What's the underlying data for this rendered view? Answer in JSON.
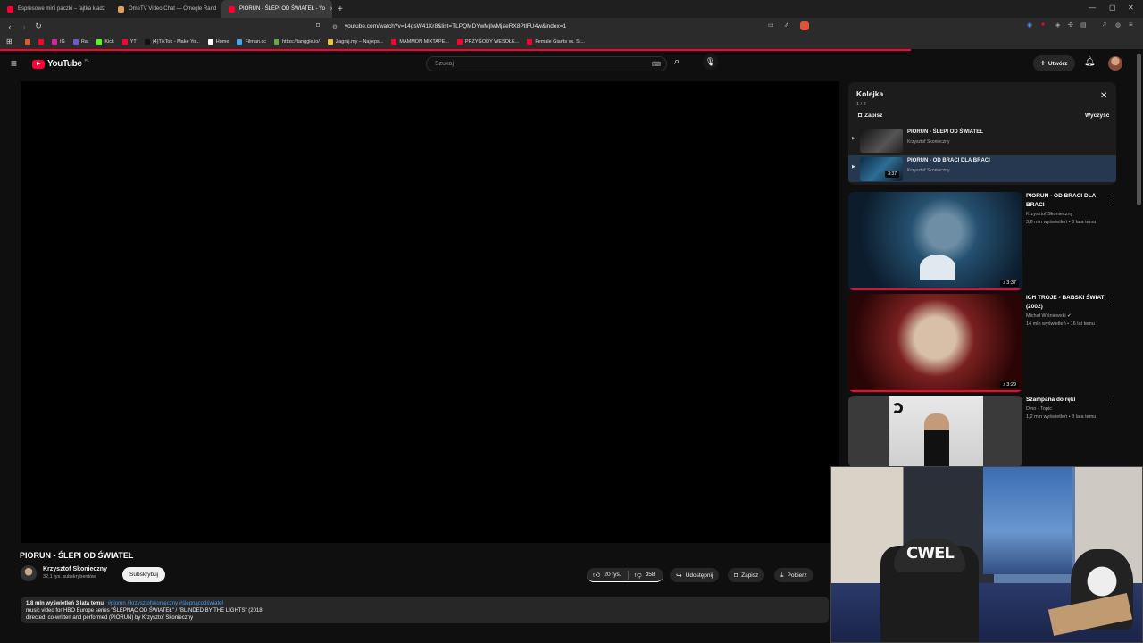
{
  "tabs": [
    {
      "label": "Espresowe mini paczki – fajtka kladz",
      "color": "#ff0033"
    },
    {
      "label": "OmeTV Video Chat — Omegle Rand",
      "color": "#e0a060"
    },
    {
      "label": "PIORUN - ŚLEPI OD ŚWIATEŁ - Yo",
      "color": "#ff0033"
    }
  ],
  "address": {
    "url": "youtube.com/watch?v=14gsW41Kr8&list=TLPQMDYwMjIwMjaeRX8PtlFU4w&index=1"
  },
  "bookmarks": [
    {
      "label": "",
      "color": "#e05a2b"
    },
    {
      "label": "",
      "color": "#ff0033"
    },
    {
      "label": "IG",
      "color": "#d6249f"
    },
    {
      "label": "Rat",
      "color": "#6b5bd1"
    },
    {
      "label": "Kick",
      "color": "#53fc18"
    },
    {
      "label": "YT",
      "color": "#ff0033"
    },
    {
      "label": "(4)TikTok - Make Yo...",
      "color": "#111111"
    },
    {
      "label": "Home",
      "color": "#ffffff"
    },
    {
      "label": "Filman.cc",
      "color": "#3fa9f5"
    },
    {
      "label": "https://tanggle.io/",
      "color": "#6aa84f"
    },
    {
      "label": "Zagraj.my – Najleps...",
      "color": "#f1c232"
    },
    {
      "label": "MAMMON MIXTAPE...",
      "color": "#ff0033"
    },
    {
      "label": "PRZYGODY WESOŁE...",
      "color": "#ff0033"
    },
    {
      "label": "Female Giants vs. St...",
      "color": "#ff0033"
    }
  ],
  "yt": {
    "logo": "YouTube",
    "region": "PL",
    "search_placeholder": "Szukaj",
    "create_label": "Utwórz"
  },
  "video": {
    "title": "PIORUN - ŚLEPI OD ŚWIATEŁ",
    "channel": "Krzysztof Skonieczny",
    "subs": "32,1 tys. subskrybentów",
    "subscribe": "Subskrybuj",
    "likes": "20 tys.",
    "dislikes": "358",
    "share": "Udostępnij",
    "save": "Zapisz",
    "download": "Pobierz",
    "views_line": "1,8 mln wyświetleń  3 lata temu",
    "hashtags": "#piorun #krzysztofskonieczny #ślepnącodświateł",
    "desc_line1": "music video for HBO Europe series \"ŚLEPNĄC OD ŚWIATEŁ\" / \"BLINDED BY THE LIGHTS\" (2018",
    "desc_line2": "directed, co-written and performed (PIORUN) by Krzysztof Skonieczny"
  },
  "queue": {
    "title": "Kolejka",
    "position": "1 / 2",
    "save": "Zapisz",
    "clear": "Wyczyść",
    "items": [
      {
        "title": "PIORUN - ŚLEPI OD ŚWIATEŁ",
        "channel": "Krzysztof Skonieczny",
        "duration": ""
      },
      {
        "title": "PIORUN - OD BRACI DLA BRACI",
        "channel": "Krzysztof Skonieczny",
        "duration": "3:37"
      }
    ]
  },
  "recommendations": [
    {
      "title": "PIORUN - OD BRACI DLA BRACI",
      "channel": "Krzysztof Skonieczny",
      "meta": "3,6 mln wyświetleń • 3 lata temu",
      "duration": "3:37",
      "verified": false
    },
    {
      "title": "ICH TROJE - BABSKI ŚWIAT (2002)",
      "channel": "Michał Wiśniewski",
      "meta": "14 mln wyświetleń • 16 lat temu",
      "duration": "3:29",
      "verified": true
    },
    {
      "title": "Szampana do ręki",
      "channel": "Dino - Topic",
      "meta": "1,2 mln wyświetleń • 3 lata temu",
      "duration": "",
      "verified": false
    }
  ],
  "webcam": {
    "cap_text": "CWEL"
  },
  "colors": {
    "accent": "#ff0033",
    "bg": "#0f0f0f"
  }
}
